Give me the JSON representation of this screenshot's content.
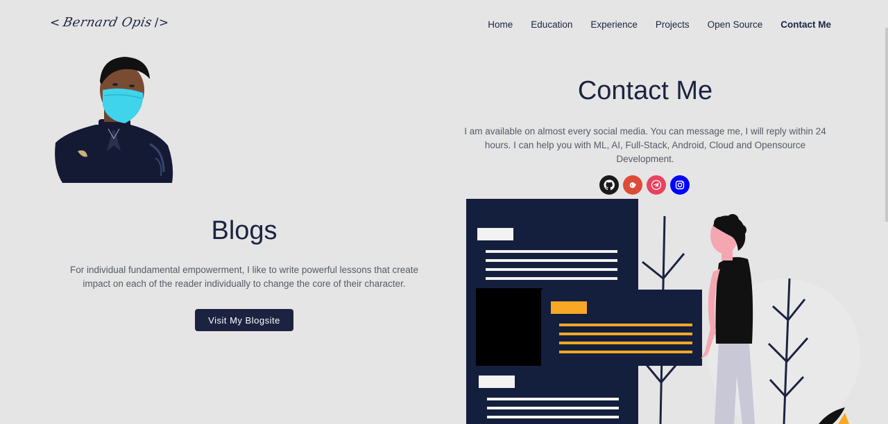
{
  "header": {
    "logo_open": "<",
    "logo_signature": "Bernard Opis",
    "logo_close": "/>",
    "nav": [
      {
        "label": "Home"
      },
      {
        "label": "Education"
      },
      {
        "label": "Experience"
      },
      {
        "label": "Projects"
      },
      {
        "label": "Open Source"
      },
      {
        "label": "Contact Me"
      }
    ]
  },
  "blogs": {
    "title": "Blogs",
    "text": "For individual fundamental empowerment, I like to write powerful lessons that create impact on each of the reader individually to change the core of their character.",
    "button_label": "Visit My Blogsite"
  },
  "contact": {
    "title": "Contact Me",
    "text": "I am available on almost every social media. You can message me, I will reply within 24 hours. I can help you with ML, AI, Full-Stack, Android, Cloud and Opensource Development.",
    "socials": [
      {
        "icon": "github-icon",
        "color": "#1a1a1a"
      },
      {
        "icon": "google-icon",
        "color": "#dd4b39"
      },
      {
        "icon": "telegram-icon",
        "color": "#e8435f"
      },
      {
        "icon": "instagram-icon",
        "color": "#0000ff"
      }
    ]
  },
  "colors": {
    "background": "#e5e5e5",
    "primary": "#1b2340",
    "accent": "#f9a825"
  }
}
